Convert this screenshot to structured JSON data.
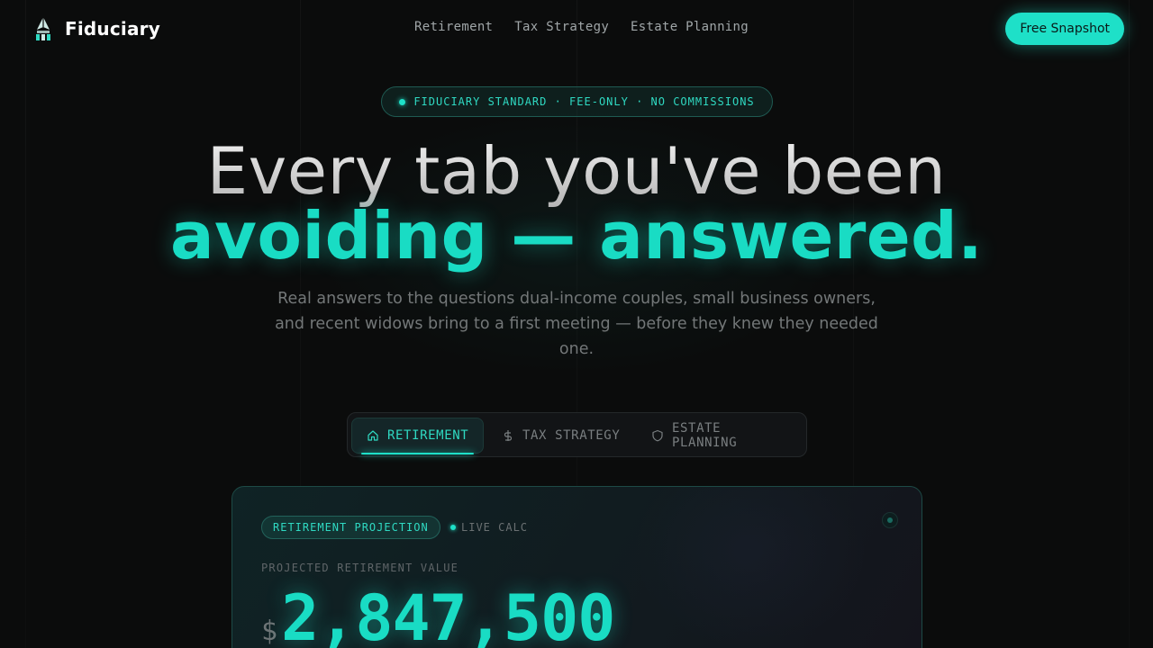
{
  "brand": {
    "name": "Fiduciary",
    "icon": "fountain-pen-logo-icon",
    "accent_color": "#1ee0c8"
  },
  "nav": {
    "links": [
      {
        "label": "Retirement"
      },
      {
        "label": "Tax Strategy"
      },
      {
        "label": "Estate Planning"
      }
    ],
    "cta_label": "Free Snapshot"
  },
  "hero": {
    "badge": "FIDUCIARY STANDARD · FEE-ONLY · NO COMMISSIONS",
    "title_line1": "Every tab you've been",
    "title_line2": "avoiding — answered.",
    "subtitle": "Real answers to the questions dual-income couples, small business owners, and recent widows bring to a first meeting — before they knew they needed one."
  },
  "tabs": [
    {
      "label": "RETIREMENT",
      "icon": "home-icon",
      "active": true
    },
    {
      "label": "TAX STRATEGY",
      "icon": "dollar-icon",
      "active": false
    },
    {
      "label": "ESTATE PLANNING",
      "icon": "shield-icon",
      "active": false
    }
  ],
  "card": {
    "pill": "RETIREMENT PROJECTION",
    "live_label": "LIVE CALC",
    "metric_label": "PROJECTED RETIREMENT VALUE",
    "currency": "$",
    "value": "2,847,500"
  }
}
